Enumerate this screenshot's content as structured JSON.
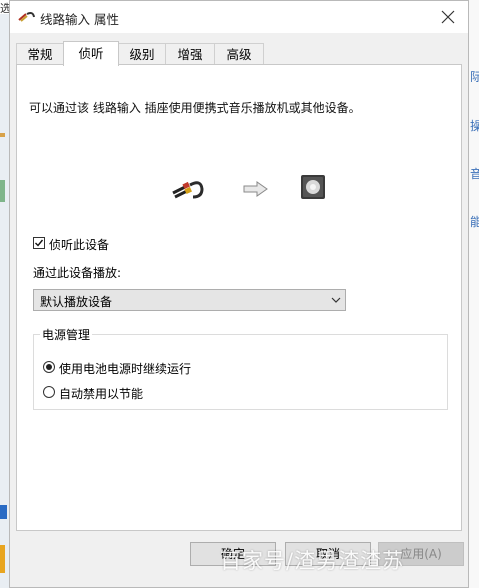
{
  "window": {
    "title": "线路输入 属性"
  },
  "background": {
    "left_text": "选",
    "right_texts": [
      "际",
      "操",
      "音",
      "能"
    ]
  },
  "tabs": [
    {
      "label": "常规",
      "active": false
    },
    {
      "label": "侦听",
      "active": true
    },
    {
      "label": "级别",
      "active": false
    },
    {
      "label": "增强",
      "active": false
    },
    {
      "label": "高级",
      "active": false
    }
  ],
  "listen": {
    "description": "可以通过该 线路输入 插座使用便携式音乐播放机或其他设备。",
    "icons": [
      "audio-cable-icon",
      "arrow-right-icon",
      "speaker-icon"
    ],
    "checkbox_label": "侦听此设备",
    "checkbox_checked": true,
    "playback_label": "通过此设备播放:",
    "playback_device": "默认播放设备",
    "power": {
      "title": "电源管理",
      "options": [
        {
          "label": "使用电池电源时继续运行",
          "selected": true
        },
        {
          "label": "自动禁用以节能",
          "selected": false
        }
      ]
    }
  },
  "buttons": {
    "ok": "确定",
    "cancel": "取消",
    "apply": "应用(A)"
  },
  "watermark": "百家号/渣男渣渣苏"
}
